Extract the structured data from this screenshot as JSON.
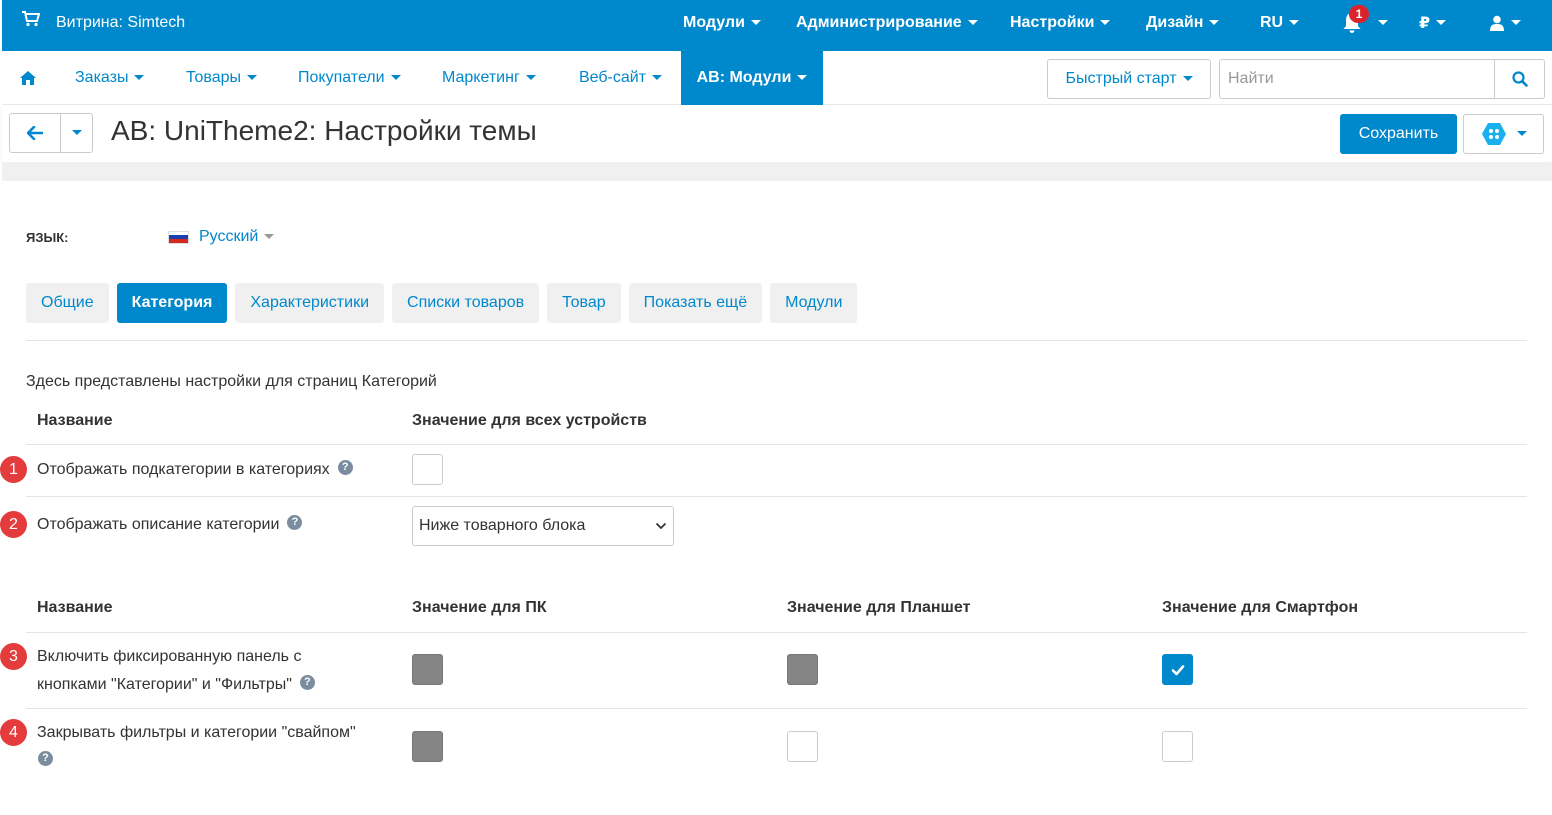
{
  "topbar": {
    "brand": "Витрина: Simtech",
    "nav": [
      {
        "label": "Модули"
      },
      {
        "label": "Администрирование"
      },
      {
        "label": "Настройки"
      },
      {
        "label": "Дизайн"
      },
      {
        "label": "RU"
      },
      {
        "label": "₽"
      }
    ],
    "notification_count": "1",
    "bg_color": "#0088cc"
  },
  "subnav": {
    "home_icon": "home-icon",
    "items": [
      {
        "label": "Заказы"
      },
      {
        "label": "Товары"
      },
      {
        "label": "Покупатели"
      },
      {
        "label": "Маркетинг"
      },
      {
        "label": "Веб-сайт"
      },
      {
        "label": "AB: Модули",
        "active": true
      }
    ],
    "quick_start": "Быстрый старт",
    "search_placeholder": "Найти"
  },
  "page": {
    "title": "AB: UniTheme2: Настройки темы",
    "save_label": "Сохранить"
  },
  "language": {
    "label": "ЯЗЫК:",
    "value": "Русский"
  },
  "tabs": [
    {
      "label": "Общие"
    },
    {
      "label": "Категория",
      "active": true
    },
    {
      "label": "Характеристики"
    },
    {
      "label": "Списки товаров"
    },
    {
      "label": "Товар"
    },
    {
      "label": "Показать ещё"
    },
    {
      "label": "Модули"
    }
  ],
  "description": "Здесь представлены настройки для страниц Категорий",
  "table1": {
    "headers": [
      "Название",
      "Значение для всех устройств"
    ],
    "rows": [
      {
        "marker": "1",
        "label": "Отображать подкатегории в категориях",
        "checked": false
      },
      {
        "marker": "2",
        "label": "Отображать описание категории",
        "select_value": "Ниже товарного блока"
      }
    ]
  },
  "table2": {
    "headers": [
      "Название",
      "Значение для ПК",
      "Значение для Планшет",
      "Значение для Смартфон"
    ],
    "rows": [
      {
        "marker": "3",
        "label_line1": "Включить фиксированную панель с",
        "label_line2": "кнопками \"Категории\" и \"Фильтры\"",
        "pc": "disabled",
        "tablet": "disabled",
        "phone": "checked"
      },
      {
        "marker": "4",
        "label": "Закрывать фильтры и категории \"свайпом\"",
        "pc": "disabled",
        "tablet": "unchecked",
        "phone": "unchecked"
      }
    ]
  },
  "colors": {
    "accent": "#0088cc",
    "marker": "#e43c3c",
    "disabled_checkbox": "#858585"
  }
}
